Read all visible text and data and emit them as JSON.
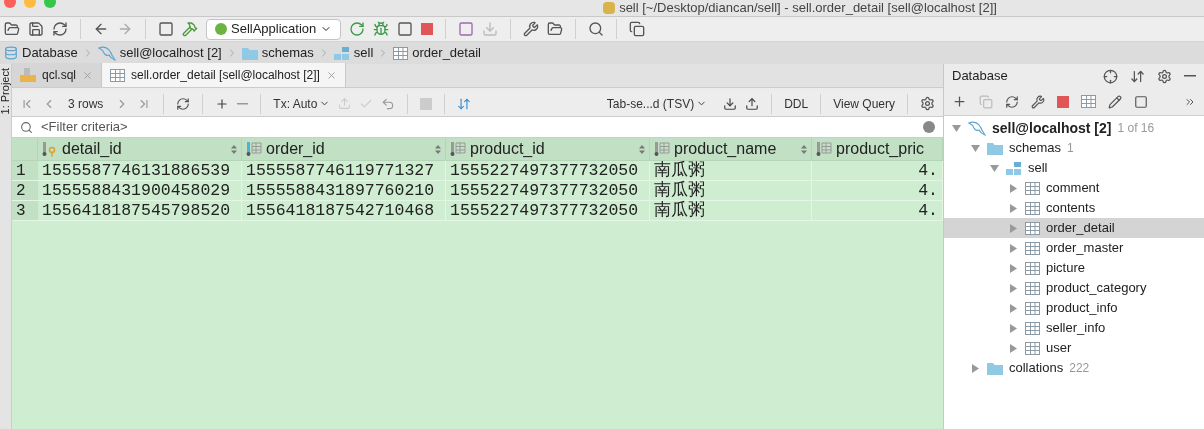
{
  "window": {
    "title": "sell [~/Desktop/diancan/sell] - sell.order_detail [sell@localhost [2]]"
  },
  "toolbar": {
    "run_config": "SellApplication"
  },
  "breadcrumb": [
    {
      "label": "Database",
      "kind": "database"
    },
    {
      "label": "sell@localhost [2]",
      "kind": "connection"
    },
    {
      "label": "schemas",
      "kind": "folder"
    },
    {
      "label": "sell",
      "kind": "schema"
    },
    {
      "label": "order_detail",
      "kind": "table"
    }
  ],
  "side_stripe": {
    "label": "1: Project"
  },
  "editor_tabs": [
    {
      "label": "qcl.sql",
      "kind": "sql",
      "selected": false
    },
    {
      "label": "sell.order_detail [sell@localhost [2]]",
      "kind": "table",
      "selected": true
    }
  ],
  "grid_toolbar": {
    "rows": "3 rows",
    "tx": "Tx: Auto",
    "format": "Tab-se...d (TSV)",
    "ddl": "DDL",
    "view_query": "View Query"
  },
  "filter": {
    "placeholder": "<Filter criteria>"
  },
  "table": {
    "columns": [
      {
        "name": "detail_id",
        "kind": "key",
        "sort_arrows": true
      },
      {
        "name": "order_id",
        "kind": "index",
        "sort_arrows": true
      },
      {
        "name": "product_id",
        "kind": "column",
        "sort_arrows": true
      },
      {
        "name": "product_name",
        "kind": "column",
        "sort_arrows": true
      },
      {
        "name": "product_pric",
        "kind": "column",
        "sort_arrows": false
      }
    ],
    "rows": [
      {
        "number": "1",
        "cells": [
          "1555587746131886539",
          "1555587746119771327",
          "1555227497377732050",
          "南瓜粥",
          "4."
        ]
      },
      {
        "number": "2",
        "cells": [
          "1555588431900458029",
          "1555588431897760210",
          "1555227497377732050",
          "南瓜粥",
          "4."
        ]
      },
      {
        "number": "3",
        "cells": [
          "1556418187545798520",
          "1556418187542710468",
          "1555227497377732050",
          "南瓜粥",
          "4."
        ]
      }
    ]
  },
  "database_panel": {
    "title": "Database",
    "tree": [
      {
        "label": "sell@localhost [2]",
        "kind": "connection",
        "count": "1 of 16",
        "expanded": true,
        "selected": false,
        "children": [
          {
            "label": "schemas",
            "kind": "folder",
            "count": "1",
            "expanded": true,
            "selected": false,
            "children": [
              {
                "label": "sell",
                "kind": "schema",
                "expanded": true,
                "selected": false,
                "children": [
                  {
                    "label": "comment",
                    "kind": "table",
                    "expanded": false,
                    "selected": false
                  },
                  {
                    "label": "contents",
                    "kind": "table",
                    "expanded": false,
                    "selected": false
                  },
                  {
                    "label": "order_detail",
                    "kind": "table",
                    "expanded": false,
                    "selected": true
                  },
                  {
                    "label": "order_master",
                    "kind": "table",
                    "expanded": false,
                    "selected": false
                  },
                  {
                    "label": "picture",
                    "kind": "table",
                    "expanded": false,
                    "selected": false
                  },
                  {
                    "label": "product_category",
                    "kind": "table",
                    "expanded": false,
                    "selected": false
                  },
                  {
                    "label": "product_info",
                    "kind": "table",
                    "expanded": false,
                    "selected": false
                  },
                  {
                    "label": "seller_info",
                    "kind": "table",
                    "expanded": false,
                    "selected": false
                  },
                  {
                    "label": "user",
                    "kind": "table",
                    "expanded": false,
                    "selected": false
                  }
                ]
              }
            ]
          },
          {
            "label": "collations",
            "kind": "folder",
            "count": "222",
            "expanded": false,
            "selected": false
          }
        ]
      }
    ]
  }
}
